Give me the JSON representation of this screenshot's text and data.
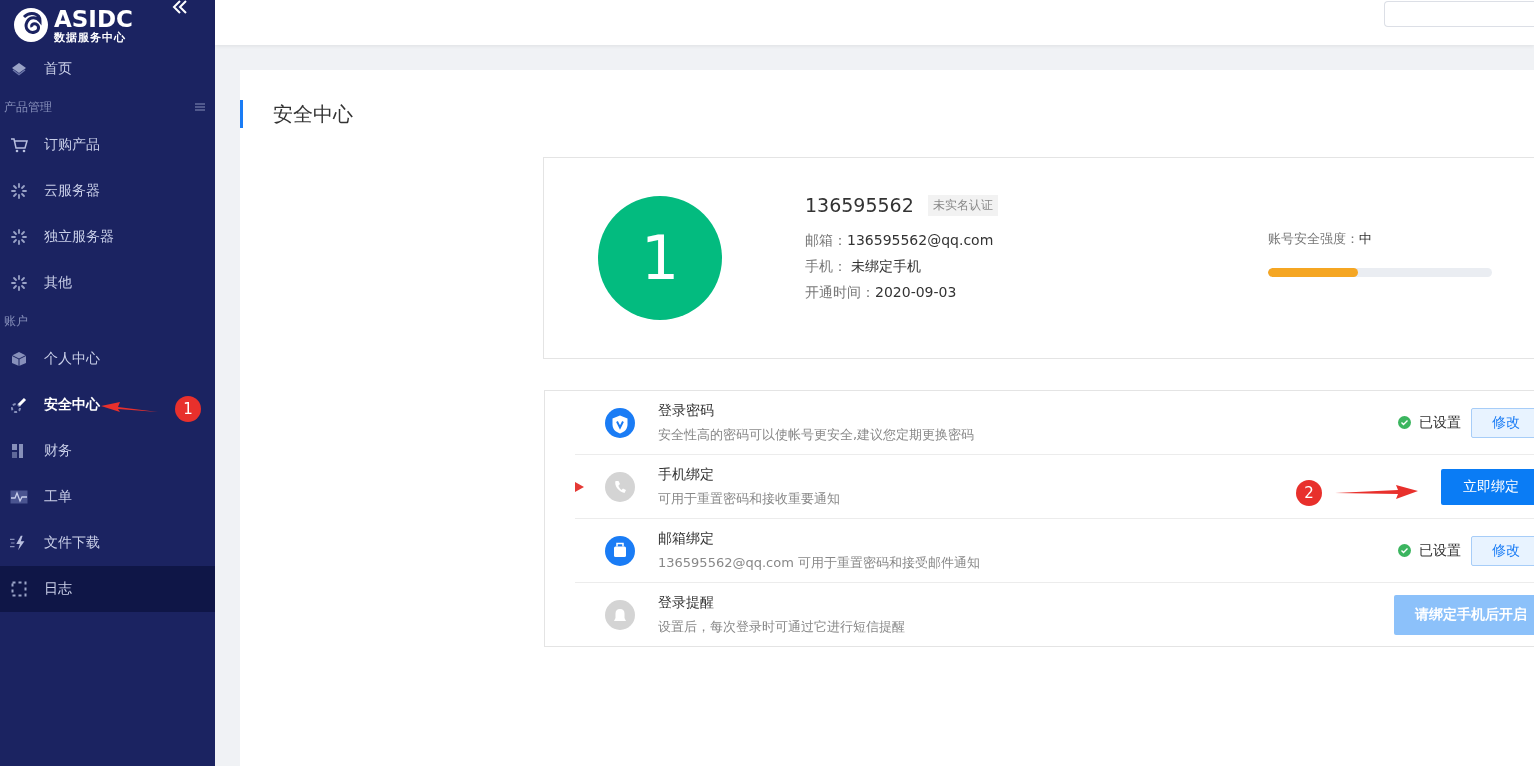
{
  "sidebar": {
    "logo": {
      "title": "ASIDC",
      "subtitle": "数据服务中心"
    },
    "items": [
      {
        "kind": "item",
        "label": "首页",
        "selected": false,
        "highlighted": false
      },
      {
        "kind": "group",
        "label": "产品管理"
      },
      {
        "kind": "item",
        "label": "订购产品",
        "selected": false,
        "highlighted": false
      },
      {
        "kind": "item",
        "label": "云服务器",
        "selected": false,
        "highlighted": false
      },
      {
        "kind": "item",
        "label": "独立服务器",
        "selected": false,
        "highlighted": false
      },
      {
        "kind": "item",
        "label": "其他",
        "selected": false,
        "highlighted": false
      },
      {
        "kind": "group",
        "label": "账户"
      },
      {
        "kind": "item",
        "label": "个人中心",
        "selected": false,
        "highlighted": false
      },
      {
        "kind": "item",
        "label": "安全中心",
        "selected": true,
        "highlighted": false
      },
      {
        "kind": "item",
        "label": "财务",
        "selected": false,
        "highlighted": false
      },
      {
        "kind": "item",
        "label": "工单",
        "selected": false,
        "highlighted": false
      },
      {
        "kind": "item",
        "label": "文件下载",
        "selected": false,
        "highlighted": false
      },
      {
        "kind": "item",
        "label": "日志",
        "selected": false,
        "highlighted": true
      }
    ]
  },
  "page": {
    "title": "安全中心"
  },
  "profile": {
    "avatar": "1",
    "username": "136595562",
    "badge": "未实名认证",
    "fields": [
      {
        "label": "邮箱：",
        "value": "136595562@qq.com"
      },
      {
        "label": "手机： ",
        "value": "未绑定手机"
      },
      {
        "label": "开通时间：",
        "value": "2020-09-03"
      }
    ],
    "strength": {
      "label": "账号安全强度：",
      "value": "中",
      "level": 0.4
    }
  },
  "security_items": [
    {
      "title": "登录密码",
      "description": "安全性高的密码可以使帐号更安全,建议您定期更换密码",
      "set": true,
      "status": "已设置",
      "pointer": false,
      "button": {
        "kind": "outline",
        "label": "修改"
      }
    },
    {
      "title": "手机绑定",
      "description": "可用于重置密码和接收重要通知",
      "set": false,
      "pointer": true,
      "button": {
        "kind": "primary",
        "label": "立即绑定"
      }
    },
    {
      "title": "邮箱绑定",
      "description": "136595562@qq.com 可用于重置密码和接受邮件通知",
      "set": true,
      "status": "已设置",
      "pointer": false,
      "button": {
        "kind": "outline",
        "label": "修改"
      }
    },
    {
      "title": "登录提醒",
      "description": "设置后，每次登录时可通过它进行短信提醒",
      "set": false,
      "pointer": false,
      "button": {
        "kind": "disabled",
        "label": "请绑定手机后开启"
      }
    }
  ],
  "annotations": [
    {
      "label": "1"
    },
    {
      "label": "2"
    }
  ]
}
